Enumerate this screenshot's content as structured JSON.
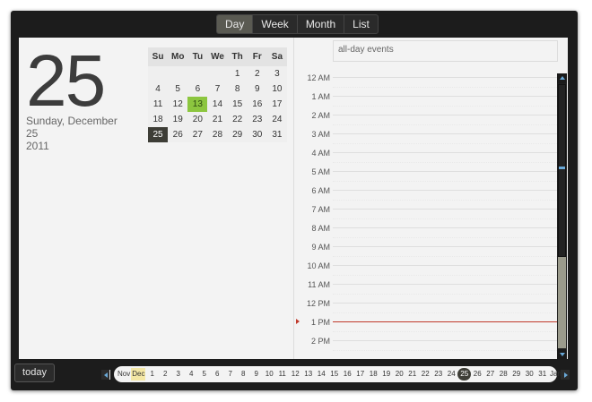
{
  "views": [
    "Day",
    "Week",
    "Month",
    "List"
  ],
  "active_view": "Day",
  "date_panel": {
    "big_day": "25",
    "line1": "Sunday, December",
    "line2": "25",
    "line3": "2011"
  },
  "mini_calendar": {
    "weekdays": [
      "Su",
      "Mo",
      "Tu",
      "We",
      "Th",
      "Fr",
      "Sa"
    ],
    "weeks": [
      [
        "",
        "",
        "",
        "",
        "1",
        "2",
        "3"
      ],
      [
        "4",
        "5",
        "6",
        "7",
        "8",
        "9",
        "10"
      ],
      [
        "11",
        "12",
        "13",
        "14",
        "15",
        "16",
        "17"
      ],
      [
        "18",
        "19",
        "20",
        "21",
        "22",
        "23",
        "24"
      ],
      [
        "25",
        "26",
        "27",
        "28",
        "29",
        "30",
        "31"
      ]
    ],
    "highlighted": "13",
    "selected": "25"
  },
  "day_view": {
    "allday_label": "all-day events",
    "hours": [
      "12 AM",
      "1 AM",
      "2 AM",
      "3 AM",
      "4 AM",
      "5 AM",
      "6 AM",
      "7 AM",
      "8 AM",
      "9 AM",
      "10 AM",
      "11 AM",
      "12 PM",
      "1 PM",
      "2 PM"
    ],
    "now_hour": 13
  },
  "toolbar": {
    "today_label": "today"
  },
  "date_strip": {
    "prev_month": "Nov",
    "current_month": "Dec",
    "days": [
      "1",
      "2",
      "3",
      "4",
      "5",
      "6",
      "7",
      "8",
      "9",
      "10",
      "11",
      "12",
      "13",
      "14",
      "15",
      "16",
      "17",
      "18",
      "19",
      "20",
      "21",
      "22",
      "23",
      "24",
      "25",
      "26",
      "27",
      "28",
      "29",
      "30",
      "31"
    ],
    "current_day": "25",
    "next_month": "Jan"
  },
  "colors": {
    "highlight": "#8cc63f",
    "selected": "#3d3d36",
    "now_line": "#c0392b",
    "frame": "#1c1c1c"
  }
}
